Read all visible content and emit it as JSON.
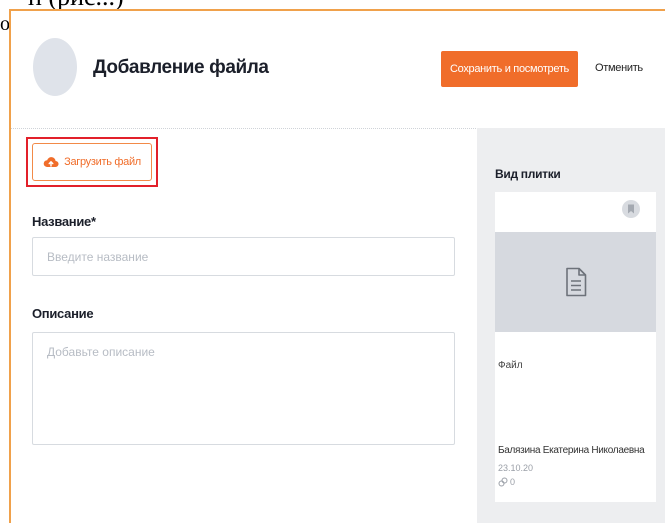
{
  "doc_fragment": {
    "top_text": "п (рис...)",
    "left_letter": "о"
  },
  "header": {
    "title": "Добавление файла",
    "save_button": "Сохранить и посмотреть",
    "cancel_button": "Отменить"
  },
  "form": {
    "upload_button": "Загрузить файл",
    "name_label": "Название*",
    "name_placeholder": "Введите название",
    "name_value": "",
    "description_label": "Описание",
    "description_placeholder": "Добавьте описание",
    "description_value": ""
  },
  "preview": {
    "heading": "Вид плитки",
    "tile": {
      "name": "Файл",
      "author": "Балязина Екатерина Николаевна",
      "date": "23.10.20",
      "count": "0"
    }
  },
  "colors": {
    "accent": "#f06d2a",
    "highlight": "#e2202a",
    "frame": "#f0a14b",
    "panel": "#edeef0"
  },
  "icons": {
    "upload": "cloud-upload-icon",
    "bookmark": "bookmark-icon",
    "file": "document-icon",
    "views": "views-icon"
  }
}
